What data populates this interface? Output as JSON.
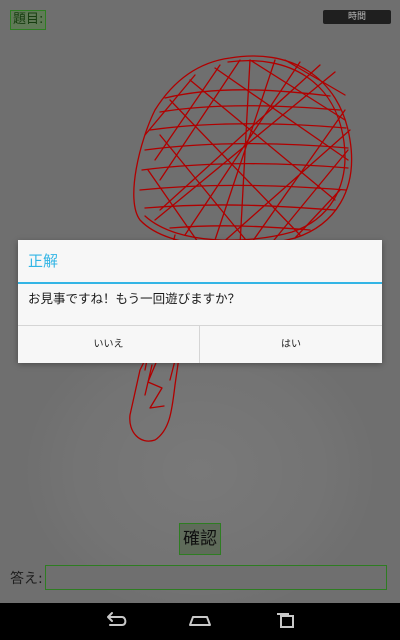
{
  "header": {
    "topic_label": "題目:",
    "time_button": "時間"
  },
  "main": {
    "confirm_label": "確認",
    "answer_label": "答え:",
    "answer_value": ""
  },
  "dialog": {
    "title": "正解",
    "message": "お見事ですね！もう一回遊びますか？",
    "no_label": "いいえ",
    "yes_label": "はい"
  },
  "navbar": {
    "icons": [
      "back-icon",
      "home-icon",
      "recent-apps-icon"
    ]
  },
  "colors": {
    "accent": "#33b5e5",
    "drawing": "#b00000",
    "border_green": "#2e7d22"
  }
}
